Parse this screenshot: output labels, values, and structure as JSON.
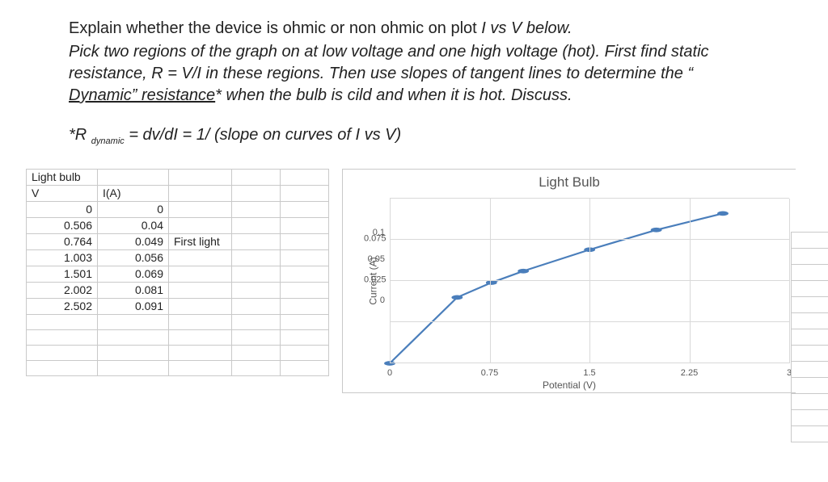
{
  "prompt": {
    "l1a": "Explain whether the device is ohmic or non ohmic on plot ",
    "l1b": "I vs V below.",
    "l2": "Pick two regions of the graph on at low voltage and one high voltage (hot). First find static resistance, R = V/I in these regions. Then use slopes of tangent lines to determine the “ ",
    "l2u": "Dynamic” resistance",
    "l2c": "* when the bulb is cild and when it is hot. Discuss.",
    "l3a": "*R ",
    "l3sub": "dynamic",
    "l3b": "  = dv/dI = 1/ (slope on curves of I vs V)"
  },
  "table": {
    "title": "Light bulb",
    "col1": "V",
    "col2": "I(A)",
    "note": "First light",
    "rows": [
      {
        "v": "0",
        "i": "0"
      },
      {
        "v": "0.506",
        "i": "0.04"
      },
      {
        "v": "0.764",
        "i": "0.049",
        "note": true
      },
      {
        "v": "1.003",
        "i": "0.056"
      },
      {
        "v": "1.501",
        "i": "0.069"
      },
      {
        "v": "2.002",
        "i": "0.081"
      },
      {
        "v": "2.502",
        "i": "0.091"
      }
    ]
  },
  "chart_data": {
    "type": "line",
    "title": "Light Bulb",
    "xlabel": "Potential (V)",
    "ylabel": "Current (A)",
    "xlim": [
      0,
      3
    ],
    "ylim": [
      0,
      0.1
    ],
    "xticks": [
      0,
      0.75,
      1.5,
      2.25,
      3
    ],
    "yticks": [
      0,
      0.025,
      0.05,
      0.075,
      0.1
    ],
    "x": [
      0,
      0.506,
      0.764,
      1.003,
      1.501,
      2.002,
      2.502
    ],
    "y": [
      0,
      0.04,
      0.049,
      0.056,
      0.069,
      0.081,
      0.091
    ]
  }
}
